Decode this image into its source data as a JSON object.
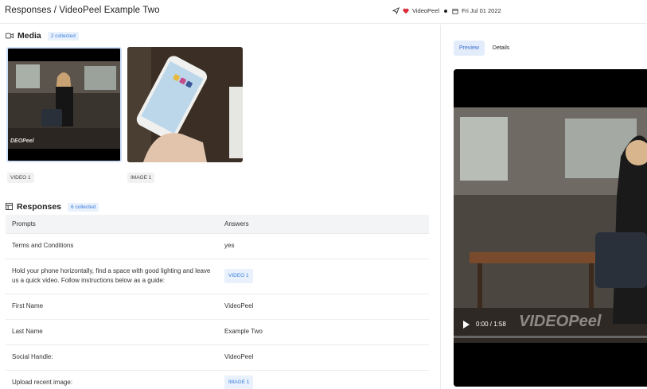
{
  "header": {
    "breadcrumb": "Responses / VideoPeel Example Two",
    "brand": "VideoPeel",
    "date": "Fri Jul 01 2022"
  },
  "media": {
    "title": "Media",
    "badge": "2 collected",
    "items": [
      {
        "tag": "VIDEO 1",
        "watermark": "DEOPeel"
      },
      {
        "tag": "IMAGE 1"
      }
    ]
  },
  "responses": {
    "title": "Responses",
    "badge": "6 collected",
    "columns": [
      "Prompts",
      "Answers"
    ],
    "rows": [
      {
        "prompt": "Terms and Conditions",
        "answer": "yes"
      },
      {
        "prompt": "Hold your phone horizontally, find a space with good lighting and leave us a quick video. Follow instructions below as a guide:",
        "answer": "VIDEO 1"
      },
      {
        "prompt": "First Name",
        "answer": "VideoPeel"
      },
      {
        "prompt": "Last Name",
        "answer": "Example Two"
      },
      {
        "prompt": "Social Handle:",
        "answer": "VideoPeel"
      },
      {
        "prompt": "Upload recent image:",
        "answer": "IMAGE 1"
      }
    ]
  },
  "preview": {
    "tabs": [
      "Preview",
      "Details"
    ],
    "time": "0:00 / 1:58",
    "watermark": "VIDEOPeel"
  },
  "colors": {
    "accent": "#3b7ddd",
    "accent_bg": "#e8f1fc",
    "heart": "#d92b3a"
  }
}
